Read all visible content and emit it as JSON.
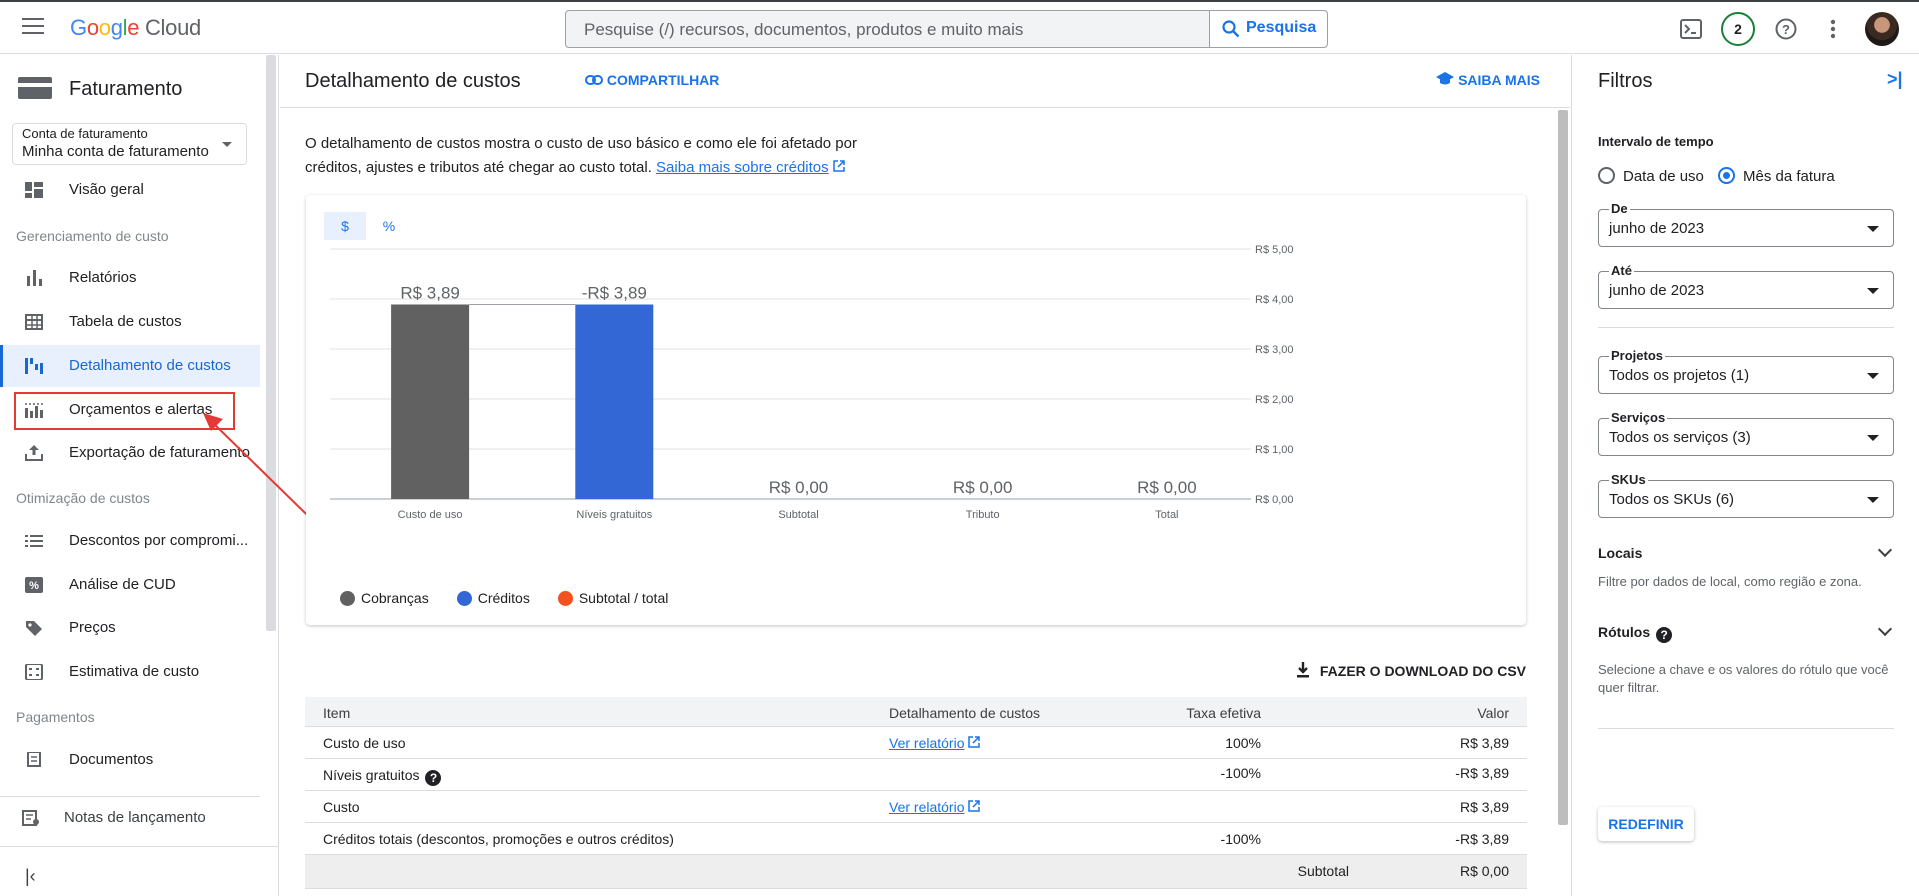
{
  "header": {
    "logo": "Google Cloud",
    "search_placeholder": "Pesquise (/) recursos, documentos, produtos e muito mais",
    "search_button": "Pesquisa",
    "notification_count": "2"
  },
  "sidebar": {
    "title": "Faturamento",
    "account_label": "Conta de faturamento",
    "account_value": "Minha conta de faturamento",
    "overview": "Visão geral",
    "section_cost_mgmt": "Gerenciamento de custo",
    "items_cost_mgmt": [
      "Relatórios",
      "Tabela de custos",
      "Detalhamento de custos",
      "Orçamentos e alertas",
      "Exportação de faturamento"
    ],
    "section_optimization": "Otimização de custos",
    "items_optimization": [
      "Descontos por compromi...",
      "Análise de CUD",
      "Preços",
      "Estimativa de custo"
    ],
    "section_payments": "Pagamentos",
    "items_payments": [
      "Documentos"
    ],
    "release_notes": "Notas de lançamento"
  },
  "main": {
    "title": "Detalhamento de custos",
    "share": "COMPARTILHAR",
    "learn_more": "SAIBA MAIS",
    "description": "O detalhamento de custos mostra o custo de uso básico e como ele foi afetado por créditos, ajustes e tributos até chegar ao custo total.",
    "description_link": "Saiba mais sobre créditos",
    "toggle_dollar": "$",
    "toggle_percent": "%",
    "download": "FAZER O DOWNLOAD DO CSV"
  },
  "chart_data": {
    "type": "bar",
    "categories": [
      "Custo de uso",
      "Níveis gratuitos",
      "Subtotal",
      "Tributo",
      "Total"
    ],
    "values": [
      3.89,
      -3.89,
      0,
      0,
      0
    ],
    "data_labels": [
      "R$ 3,89",
      "-R$ 3,89",
      "R$ 0,00",
      "R$ 0,00",
      "R$ 0,00"
    ],
    "bar_colors": [
      "#616161",
      "#3367d6",
      "#f4511e",
      "#616161",
      "#f4511e"
    ],
    "y_ticks": [
      "R$ 5,00",
      "R$ 4,00",
      "R$ 3,00",
      "R$ 2,00",
      "R$ 1,00",
      "R$ 0,00"
    ],
    "ylim": [
      0,
      5
    ],
    "legend": [
      {
        "name": "Cobranças",
        "color": "#616161"
      },
      {
        "name": "Créditos",
        "color": "#3367d6"
      },
      {
        "name": "Subtotal / total",
        "color": "#f4511e"
      }
    ],
    "grid": true
  },
  "table": {
    "headers": [
      "Item",
      "Detalhamento de custos",
      "Taxa efetiva",
      "Valor"
    ],
    "rows": [
      {
        "item": "Custo de uso",
        "link": "Ver relatório",
        "rate": "100%",
        "value": "R$ 3,89"
      },
      {
        "item": "Níveis gratuitos",
        "link": "",
        "rate": "-100%",
        "value": "-R$ 3,89"
      },
      {
        "item": "Custo",
        "link": "Ver relatório",
        "rate": "",
        "value": "R$ 3,89"
      },
      {
        "item": "Créditos totais (descontos, promoções e outros créditos)",
        "link": "",
        "rate": "-100%",
        "value": "-R$ 3,89"
      }
    ],
    "subtotal_label": "Subtotal",
    "subtotal_value": "R$ 0,00"
  },
  "filters": {
    "title": "Filtros",
    "time_range": "Intervalo de tempo",
    "radio_usage": "Data de uso",
    "radio_invoice": "Mês da fatura",
    "from_label": "De",
    "from_value": "junho de 2023",
    "to_label": "Até",
    "to_value": "junho de 2023",
    "projects_label": "Projetos",
    "projects_value": "Todos os projetos (1)",
    "services_label": "Serviços",
    "services_value": "Todos os serviços (3)",
    "skus_label": "SKUs",
    "skus_value": "Todos os SKUs (6)",
    "locations_title": "Locais",
    "locations_desc": "Filtre por dados de local, como região e zona.",
    "labels_title": "Rótulos",
    "labels_desc": "Selecione a chave e os valores do rótulo que você quer filtrar.",
    "reset": "REDEFINIR"
  }
}
